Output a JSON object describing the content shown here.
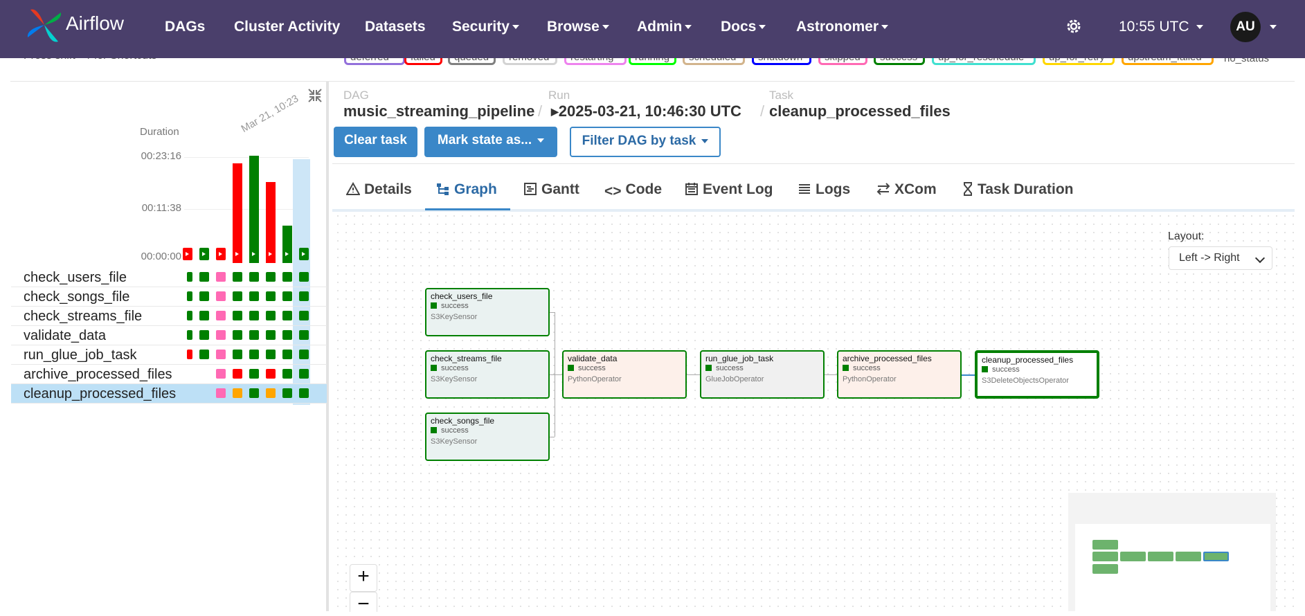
{
  "navbar": {
    "brand": "Airflow",
    "items": [
      "DAGs",
      "Cluster Activity",
      "Datasets",
      "Security",
      "Browse",
      "Admin",
      "Docs",
      "Astronomer"
    ],
    "time": "10:55 UTC",
    "user_initials": "AU"
  },
  "legend": {
    "shortcut_text": "Press shift + / for Shortcuts",
    "states": [
      "deferred",
      "failed",
      "queued",
      "removed",
      "restarting",
      "running",
      "scheduled",
      "shutdown",
      "skipped",
      "success",
      "up_for_reschedule",
      "up_for_retry",
      "upstream_failed"
    ],
    "no_status": "no_status",
    "colors": {
      "success": "#008000",
      "failed": "#ff0000",
      "upstream_failed": "#ffa500",
      "skipped": "#ff69b4",
      "queued": "#808080",
      "running": "#00ff00"
    }
  },
  "grid": {
    "duration_label": "Duration",
    "run_date": "Mar 21, 10:23",
    "y_ticks": [
      "00:23:16",
      "00:11:38",
      "00:00:00"
    ],
    "runs": [
      {
        "state": "failed",
        "duration_ratio": 0.0
      },
      {
        "state": "success",
        "duration_ratio": 0.0
      },
      {
        "state": "failed",
        "duration_ratio": 0.0
      },
      {
        "state": "failed",
        "duration_ratio": 0.9
      },
      {
        "state": "success",
        "duration_ratio": 0.97
      },
      {
        "state": "failed",
        "duration_ratio": 0.73
      },
      {
        "state": "success",
        "duration_ratio": 0.34
      },
      {
        "state": "success",
        "duration_ratio": 0.0
      }
    ],
    "tasks": [
      {
        "name": "check_users_file",
        "states": [
          "success",
          "success",
          "skipped",
          "success",
          "success",
          "success",
          "success",
          "success"
        ]
      },
      {
        "name": "check_songs_file",
        "states": [
          "success",
          "success",
          "skipped",
          "success",
          "success",
          "success",
          "success",
          "success"
        ]
      },
      {
        "name": "check_streams_file",
        "states": [
          "success",
          "success",
          "skipped",
          "success",
          "success",
          "success",
          "success",
          "success"
        ]
      },
      {
        "name": "validate_data",
        "states": [
          "success",
          "success",
          "skipped",
          "success",
          "success",
          "success",
          "success",
          "success"
        ]
      },
      {
        "name": "run_glue_job_task",
        "states": [
          "failed",
          "success",
          "skipped",
          "success",
          "success",
          "success",
          "success",
          "success"
        ]
      },
      {
        "name": "archive_processed_files",
        "states": [
          null,
          null,
          "skipped",
          "failed",
          "success",
          "failed",
          "success",
          "success"
        ]
      },
      {
        "name": "cleanup_processed_files",
        "states": [
          null,
          null,
          "skipped",
          "upstream_failed",
          "success",
          "upstream_failed",
          "success",
          "success"
        ]
      }
    ],
    "selected_task": "cleanup_processed_files"
  },
  "breadcrumb": {
    "dag_label": "DAG",
    "dag": "music_streaming_pipeline",
    "run_label": "Run",
    "run": "2025-03-21, 10:46:30 UTC",
    "task_label": "Task",
    "task": "cleanup_processed_files"
  },
  "actions": {
    "clear": "Clear task",
    "mark": "Mark state as...",
    "filter": "Filter DAG by task"
  },
  "tabs": [
    "Details",
    "Graph",
    "Gantt",
    "Code",
    "Event Log",
    "Logs",
    "XCom",
    "Task Duration"
  ],
  "active_tab": "Graph",
  "graph": {
    "layout_label": "Layout:",
    "layout_value": "Left -> Right",
    "nodes": [
      {
        "name": "check_users_file",
        "status": "success",
        "operator": "S3KeySensor"
      },
      {
        "name": "check_streams_file",
        "status": "success",
        "operator": "S3KeySensor"
      },
      {
        "name": "check_songs_file",
        "status": "success",
        "operator": "S3KeySensor"
      },
      {
        "name": "validate_data",
        "status": "success",
        "operator": "PythonOperator"
      },
      {
        "name": "run_glue_job_task",
        "status": "success",
        "operator": "GlueJobOperator"
      },
      {
        "name": "archive_processed_files",
        "status": "success",
        "operator": "PythonOperator"
      },
      {
        "name": "cleanup_processed_files",
        "status": "success",
        "operator": "S3DeleteObjectsOperator"
      }
    ],
    "zoom_in": "+",
    "zoom_out": "−"
  }
}
